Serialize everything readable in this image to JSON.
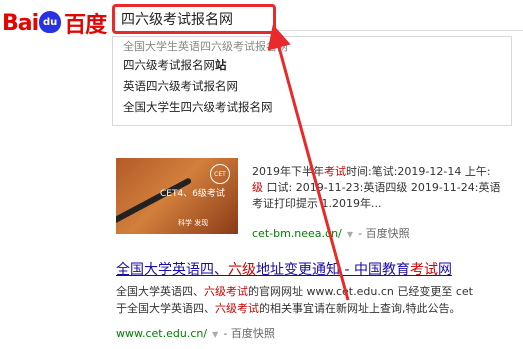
{
  "logo": {
    "left": "Bai",
    "paw": "du",
    "right": "百度"
  },
  "search": {
    "query": "四六级考试报名网"
  },
  "suggestions": {
    "top": "全国大学生英语四六级考试报名网",
    "items": [
      {
        "text": "四六级考试报名网",
        "bold": "站"
      },
      {
        "text": "英语四六级考试报名网",
        "bold": ""
      },
      {
        "text": "全国大学生四六级考试报名网",
        "bold": ""
      }
    ]
  },
  "result1": {
    "thumb": {
      "badge": "CET",
      "caption": "CET4、6级考试",
      "tags": "科学  发现"
    },
    "line1": {
      "pre": "2019年下半年",
      "hl": "考试",
      "post": "时间:笔试:2019-12-14 上午:"
    },
    "line2": {
      "hl": "级",
      "post": " 口试: 2019-11-23:英语四级 2019-11-24:英语"
    },
    "line3": "考证打印提示 1.2019年...",
    "url": "cet-bm.neea.cn/",
    "snapshot": "百度快照"
  },
  "result2": {
    "title_pre": "全国大学英语四、",
    "title_hl1": "六级",
    "title_mid": "地址变更通知 - 中国教育",
    "title_hl2": "考试",
    "title_post": "网",
    "desc1_pre": "全国大学英语四、",
    "desc1_hl": "六级考试",
    "desc1_post": "的官网网址 www.cet.edu.cn 已经变更至 cet",
    "desc2_pre": "于全国大学英语四、",
    "desc2_hl": "六级考试",
    "desc2_post": "的相关事宜请在新网址上查询,特此公告。",
    "url": "www.cet.edu.cn/",
    "snapshot": "百度快照"
  },
  "colors": {
    "accent_red": "#e82a2a",
    "link_blue": "#1a0dab",
    "url_green": "#008000",
    "baidu_red": "#e10601",
    "baidu_blue": "#2932e1"
  },
  "icons": [
    "baidu-paw-icon",
    "dropdown-caret-icon",
    "red-arrow-annotation"
  ]
}
